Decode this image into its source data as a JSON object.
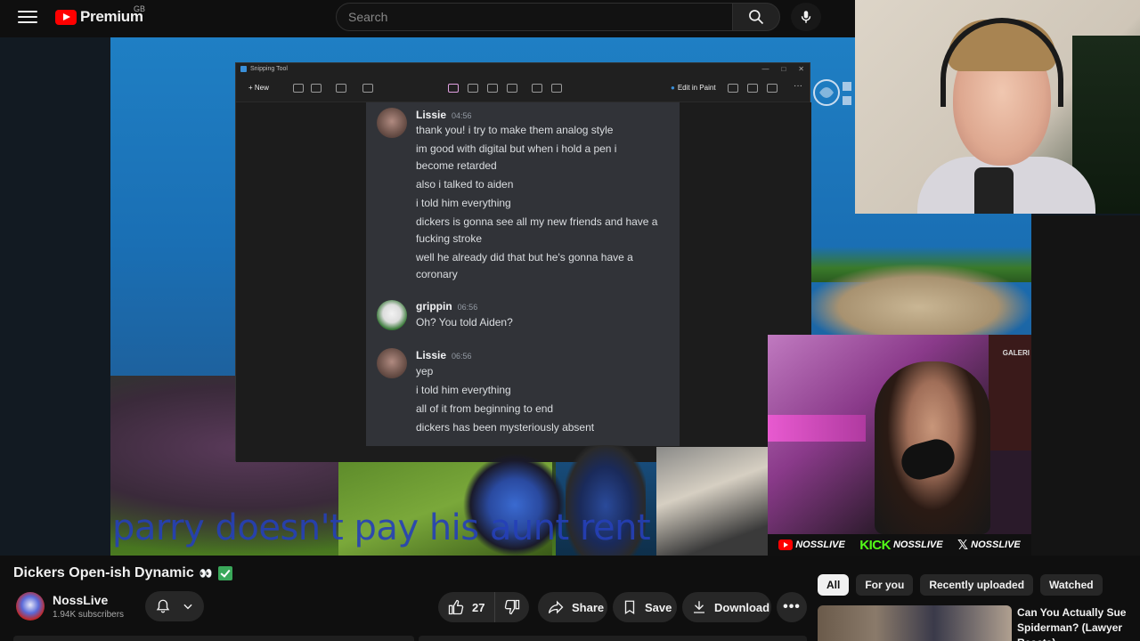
{
  "header": {
    "logo_text": "Premium",
    "region": "GB",
    "search_placeholder": "Search"
  },
  "video": {
    "overlay_text": "parry doesn't pay his aunt rent",
    "snipping_tool": {
      "window_title": "Snipping Tool",
      "new_label": "New",
      "edit_label": "Edit in Paint"
    },
    "chat": [
      {
        "user": "Lissie",
        "time": "04:56",
        "lines": [
          "thank you! i try to make them analog style",
          "im good with digital but when i hold a pen i",
          "become retarded",
          "also i talked to aiden",
          "i told him everything",
          "dickers is gonna see all my new friends and have a",
          "fucking stroke",
          "well he already did that but he's gonna have a",
          "coronary"
        ]
      },
      {
        "user": "grippin",
        "time": "06:56",
        "lines": [
          "Oh? You told Aiden?"
        ]
      },
      {
        "user": "Lissie",
        "time": "06:56",
        "lines": [
          "yep",
          "i told him everything",
          "all of it from beginning to end",
          "dickers has been mysteriously absent"
        ]
      }
    ],
    "cam_label": "GALERI",
    "socials": [
      {
        "platform": "youtube-icon",
        "handle": "NOSSLIVE"
      },
      {
        "platform": "kick-icon",
        "badge": "KICK",
        "handle": "NOSSLIVE"
      },
      {
        "platform": "x-icon",
        "handle": "NOSSLIVE"
      }
    ],
    "colors": {
      "kick": "#53fc18",
      "youtube": "#ff0000",
      "overlay_text": "#2540b8"
    }
  },
  "meta": {
    "title": "Dickers Open-ish Dynamic",
    "channel": "NossLive",
    "subscribers": "1.94K subscribers",
    "likes": "27",
    "share_label": "Share",
    "save_label": "Save",
    "download_label": "Download"
  },
  "sidebar": {
    "chips": [
      "All",
      "For you",
      "Recently uploaded",
      "Watched"
    ],
    "active_chip": "All",
    "recommended": [
      {
        "title": "Can You Actually Sue Spiderman? (Lawyer Reacts)"
      }
    ]
  }
}
